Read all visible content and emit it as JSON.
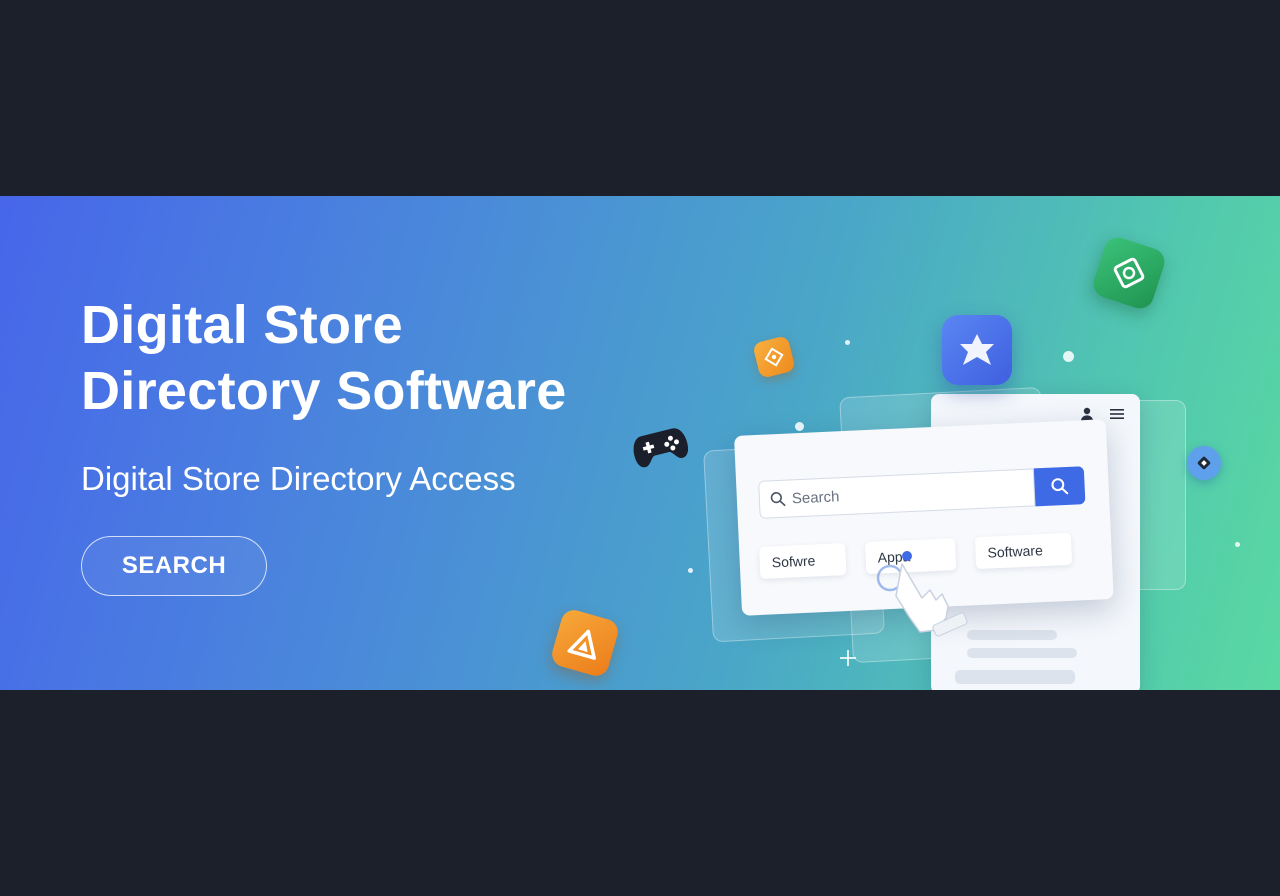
{
  "hero": {
    "title_line1": "Digital Store",
    "title_line2": "Directory Software",
    "subtitle": "Digital Store Directory Access",
    "cta_label": "SEARCH"
  },
  "mockup": {
    "search_placeholder": "Search",
    "chips": [
      "Sofwre",
      "Appa",
      "Software"
    ]
  },
  "colors": {
    "page_bg": "#1b202b",
    "gradient_start": "#4766ea",
    "gradient_end": "#5ad8a2",
    "accent_blue": "#3f6ae6",
    "tile_orange": "#f39a2c",
    "tile_green": "#27a65a",
    "tile_blue": "#4f6ee8"
  },
  "icons": [
    "search-icon",
    "user-icon",
    "menu-icon",
    "gamepad-icon",
    "star-app-icon",
    "triangle-app-icon",
    "diamond-app-icon",
    "hand-pointer-icon"
  ]
}
